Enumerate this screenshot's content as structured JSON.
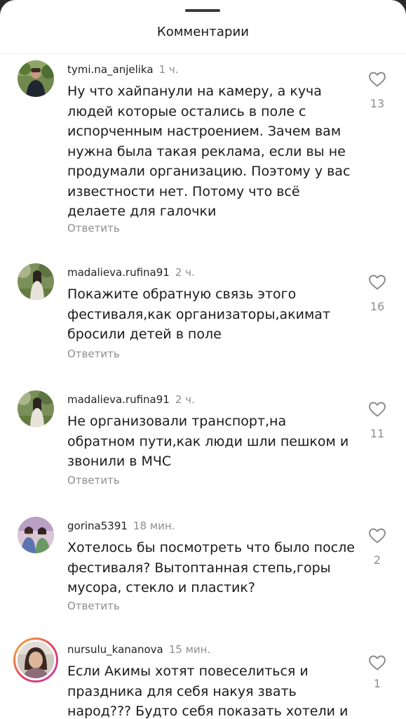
{
  "header": {
    "title": "Комментарии"
  },
  "comments": [
    {
      "username": "tymi.na_anjelika",
      "time": "1 ч.",
      "text": "Ну что хайпанули на камеру, а куча людей которые остались в поле с испорченным настроением. Зачем вам нужна была такая реклама, если вы не продумали организацию. Поэтому у вас известности нет. Потому что всё делаете для галочки",
      "reply_label": "Ответить",
      "likes": "13"
    },
    {
      "username": "madalieva.rufina91",
      "time": "2 ч.",
      "text": "Покажите обратную связь этого фестиваля,как организаторы,акимат бросили детей в поле",
      "reply_label": "Ответить",
      "likes": "16"
    },
    {
      "username": "madalieva.rufina91",
      "time": "2 ч.",
      "text": "Не организовали транспорт,на обратном пути,как люди шли пешком и звонили в МЧС",
      "reply_label": "Ответить",
      "likes": "11"
    },
    {
      "username": "gorina5391",
      "time": "18 мин.",
      "text": "Хотелось бы посмотреть что было после фестиваля? Вытоптанная степь,горы мусора, стекло и пластик?",
      "reply_label": "Ответить",
      "likes": "2"
    },
    {
      "username": "nursulu_kananova",
      "time": "15 мин.",
      "text": "Если Акимы хотят повеселиться и праздника для себя накуя звать народ??? Будто себя показать хотели и",
      "reply_label": "",
      "likes": "1"
    }
  ]
}
